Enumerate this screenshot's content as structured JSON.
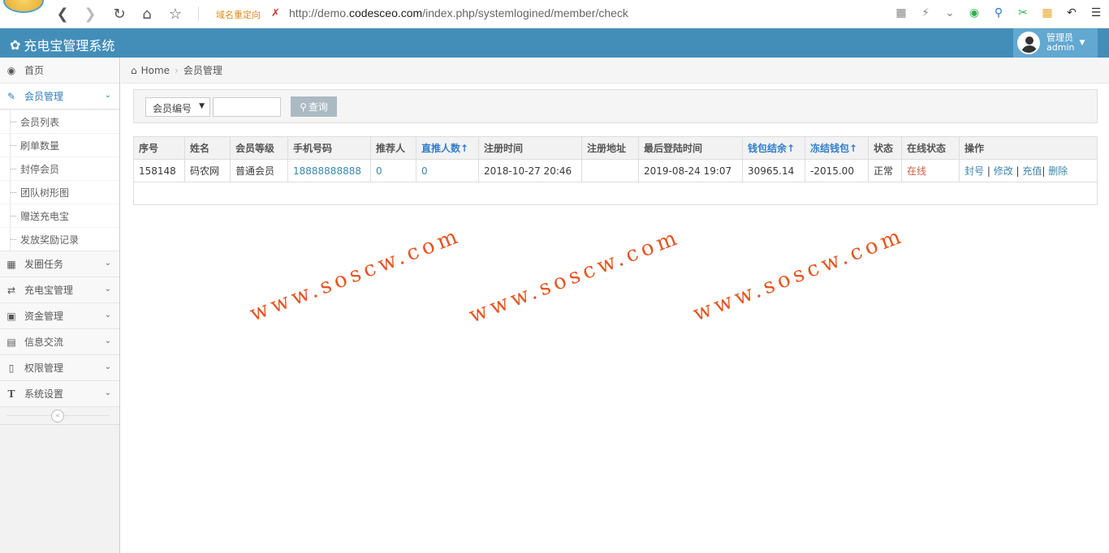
{
  "browser": {
    "redirect_label": "域名重定向",
    "url_prefix": "http://demo.",
    "url_domain": "codesceo.com",
    "url_path": "/index.php/systemlogined/member/check"
  },
  "header": {
    "title": "充电宝管理系统",
    "user_role": "管理员",
    "user_name": "admin"
  },
  "sidebar": {
    "items": [
      {
        "label": "首页",
        "icon": "dashboard-icon"
      },
      {
        "label": "会员管理",
        "icon": "edit-icon"
      },
      {
        "label": "发圈任务",
        "icon": "book-icon"
      },
      {
        "label": "充电宝管理",
        "icon": "shuffle-icon"
      },
      {
        "label": "资金管理",
        "icon": "calendar-icon"
      },
      {
        "label": "信息交流",
        "icon": "list-icon"
      },
      {
        "label": "权限管理",
        "icon": "file-icon"
      },
      {
        "label": "系统设置",
        "icon": "text-icon"
      }
    ],
    "submenu": [
      "会员列表",
      "刷单数量",
      "封停会员",
      "团队树形图",
      "赠送充电宝",
      "发放奖励记录"
    ]
  },
  "breadcrumb": {
    "home": "Home",
    "current": "会员管理"
  },
  "search": {
    "field_select": "会员编号",
    "query_label": "查询"
  },
  "table": {
    "headers": [
      "序号",
      "姓名",
      "会员等级",
      "手机号码",
      "推荐人",
      "直推人数↑",
      "注册时间",
      "注册地址",
      "最后登陆时间",
      "钱包结余↑",
      "冻结钱包↑",
      "状态",
      "在线状态",
      "操作"
    ],
    "row": {
      "id": "158148",
      "name": "码农网",
      "level": "普通会员",
      "phone": "18888888888",
      "referrer": "0",
      "direct_count": "0",
      "reg_time": "2018-10-27 20:46",
      "reg_addr": "",
      "last_login": "2019-08-24 19:07",
      "wallet": "30965.14",
      "frozen": "-2015.00",
      "status": "正常",
      "online": "在线",
      "actions": [
        "封号",
        "修改",
        "充值",
        "删除"
      ]
    }
  },
  "watermark": "www.soscw.com"
}
